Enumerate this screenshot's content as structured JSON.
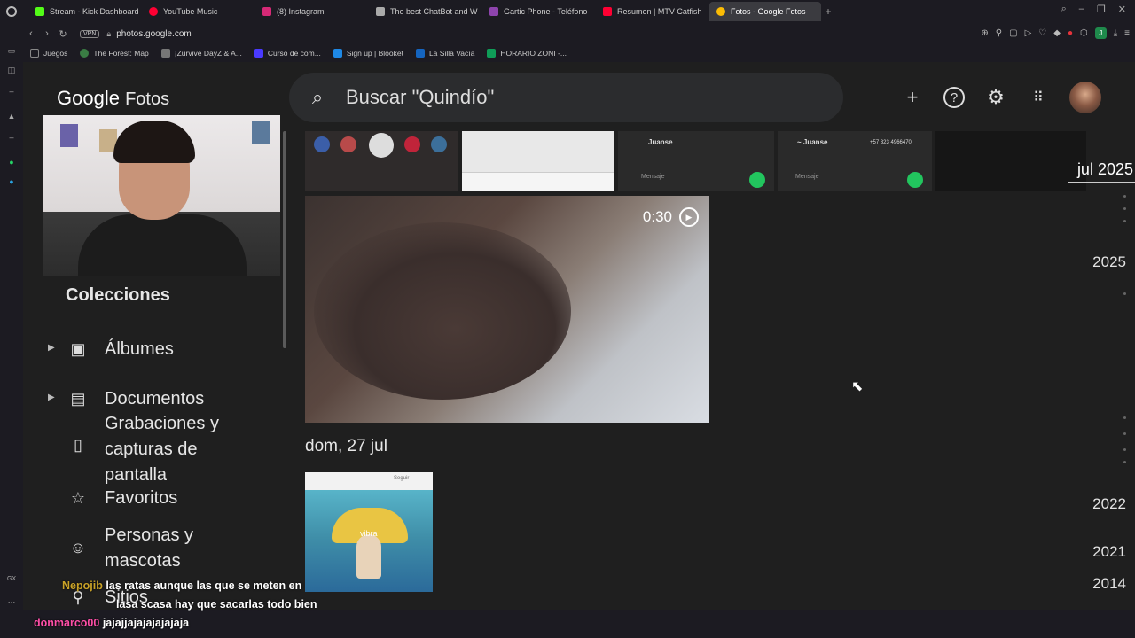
{
  "browser": {
    "tabs": [
      {
        "label": "Stream - Kick Dashboard",
        "color": "#53fc18",
        "active": false
      },
      {
        "label": "YouTube Music",
        "color": "#ff0033",
        "active": false
      },
      {
        "label": "(8) Instagram",
        "color": "#d62976",
        "active": false
      },
      {
        "label": "The best ChatBot and W",
        "color": "#aaaaaa",
        "active": false
      },
      {
        "label": "Gartic Phone - Teléfono",
        "color": "#8e44ad",
        "active": false
      },
      {
        "label": "Resumen | MTV Catfish",
        "color": "#ff0033",
        "active": false
      },
      {
        "label": "Fotos - Google Fotos",
        "color": "#fbbc04",
        "active": true
      }
    ],
    "vpn_badge": "VPN",
    "url": "photos.google.com",
    "bookmarks": [
      {
        "label": "Juegos",
        "color": "#888888"
      },
      {
        "label": "The Forest: Map",
        "color": "#3a7d44"
      },
      {
        "label": "¡Zurvive DayZ & A...",
        "color": "#777777"
      },
      {
        "label": "Curso de com...",
        "color": "#4a3aff"
      },
      {
        "label": "Sign up | Blooket",
        "color": "#1e88e5"
      },
      {
        "label": "La Silla Vacía",
        "color": "#1565c0"
      },
      {
        "label": "HORARIO ZONI -...",
        "color": "#0f9d58"
      }
    ],
    "profile_initial": "J"
  },
  "app": {
    "logo_google": "Google",
    "logo_product": "Fotos",
    "search_placeholder": "Buscar \"Quindío\"",
    "icons": [
      "add-icon",
      "help-icon",
      "settings-icon",
      "apps-icon"
    ]
  },
  "sidebar": {
    "section_title": "Colecciones",
    "items": [
      {
        "label": "Álbumes",
        "icon": "album-icon",
        "caret": true
      },
      {
        "label": "Documentos",
        "icon": "document-icon",
        "caret": true
      },
      {
        "label": "Grabaciones y capturas de pantalla",
        "icon": "phone-icon",
        "caret": false
      },
      {
        "label": "Favoritos",
        "icon": "star-icon",
        "caret": false
      },
      {
        "label": "Personas y mascotas",
        "icon": "face-icon",
        "caret": false
      },
      {
        "label": "Sitios",
        "icon": "place-icon",
        "caret": false
      }
    ]
  },
  "timeline": {
    "thumb_chat_names": [
      "Juanse",
      "~ Juanse"
    ],
    "thumb_chat_phone": "+57 323 4966470",
    "message_placeholder": "Mensaje",
    "video_duration": "0:30",
    "date_heading": "dom, 27 jul",
    "thumb_brand": "vibra",
    "thumb_follow": "Seguir"
  },
  "year_scrubber": {
    "current": "jul 2025",
    "years": [
      "2025",
      "2022",
      "2021",
      "2014"
    ]
  },
  "chat": [
    {
      "user": "Nepojib",
      "message_line1": "las ratas aunque las que se meten en",
      "message_line2": "lasa scasa hay que sacarlas todo bien"
    },
    {
      "user": "donmarco00",
      "message_line1": "jajajjajajajajajaja"
    }
  ]
}
